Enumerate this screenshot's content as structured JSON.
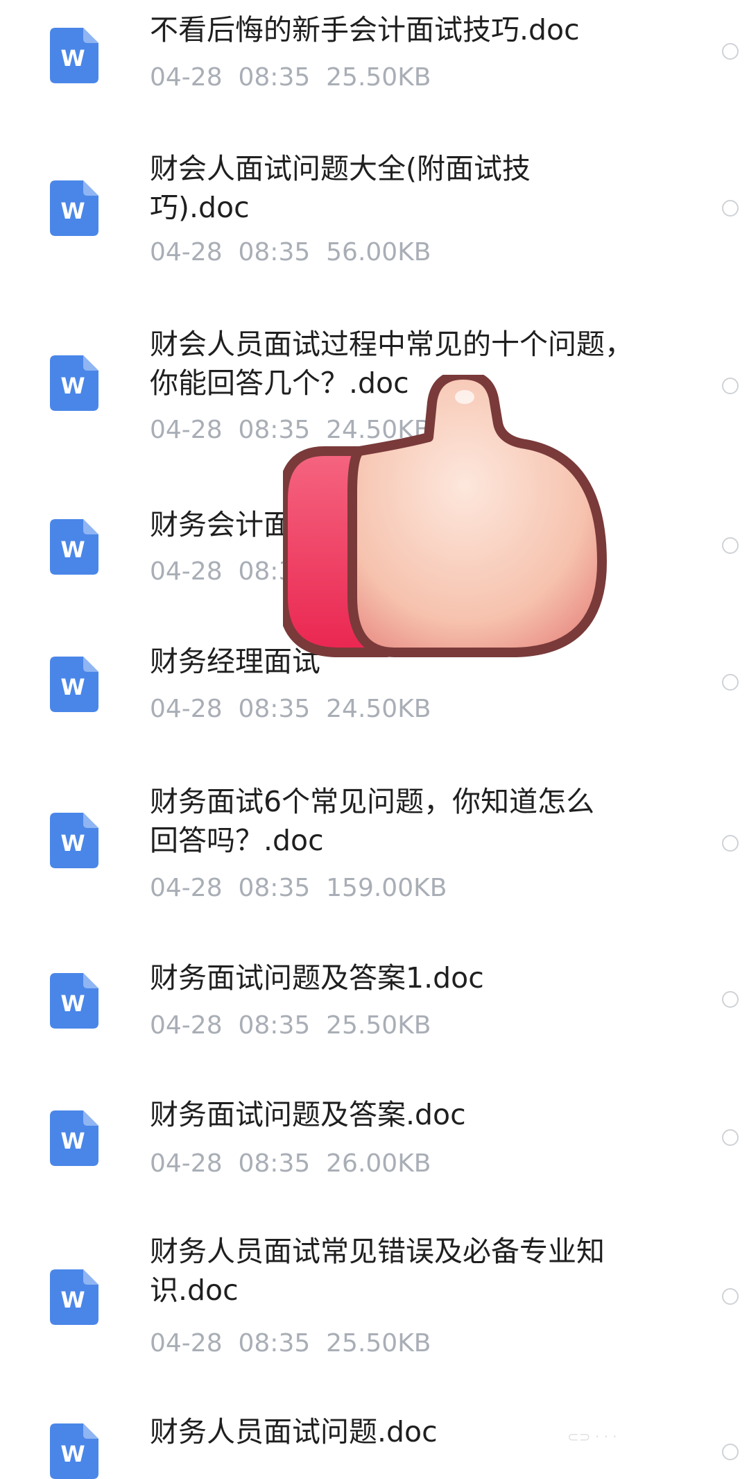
{
  "files": [
    {
      "name": "不看后悔的新手会计面试技巧.doc",
      "date": "04-28",
      "time": "08:35",
      "size": "25.50KB"
    },
    {
      "name": "财会人面试问题大全(附面试技\n巧).doc",
      "date": "04-28",
      "time": "08:35",
      "size": "56.00KB"
    },
    {
      "name": "财会人员面试过程中常见的十个问题，\n你能回答几个？.doc",
      "date": "04-28",
      "time": "08:35",
      "size": "24.50KB"
    },
    {
      "name": "财务会计面",
      "date": "04-28",
      "time": "08:3",
      "size": ""
    },
    {
      "name": "财务经理面试",
      "date": "04-28",
      "time": "08:35",
      "size": "24.50KB"
    },
    {
      "name": "财务面试6个常见问题，你知道怎么\n回答吗？.doc",
      "date": "04-28",
      "time": "08:35",
      "size": "159.00KB"
    },
    {
      "name": "财务面试问题及答案1.doc",
      "date": "04-28",
      "time": "08:35",
      "size": "25.50KB"
    },
    {
      "name": "财务面试问题及答案.doc",
      "date": "04-28",
      "time": "08:35",
      "size": "26.00KB"
    },
    {
      "name": "财务人员面试常见错误及必备专业知\n识.doc",
      "date": "04-28",
      "time": "08:35",
      "size": "25.50KB"
    },
    {
      "name": "财务人员面试问题.doc",
      "date": "",
      "time": "",
      "size": ""
    }
  ],
  "icons": {
    "file_icon": "word-doc-icon",
    "file_icon_letter": "W",
    "select": "select-circle",
    "sticker": "thumbs-up-icon"
  },
  "colors": {
    "word_blue": "#4a86e8",
    "meta_gray": "#a9aeb6",
    "title_dark": "#1f1f1f",
    "sticker_red": "#f03a62",
    "sticker_skin": "#f7c6b2",
    "sticker_outline": "#7a3a3a"
  }
}
